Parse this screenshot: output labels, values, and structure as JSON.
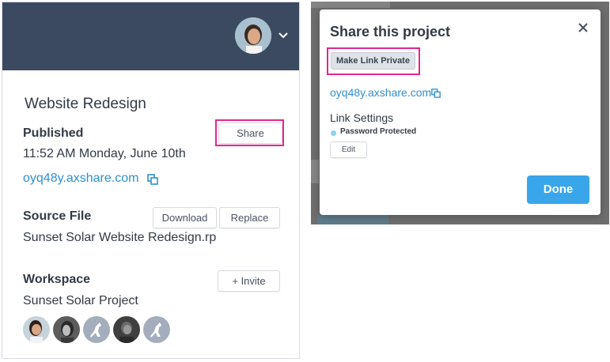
{
  "project_panel": {
    "title": "Website Redesign",
    "published": {
      "label": "Published",
      "timestamp": "11:52 AM Monday, June 10th",
      "link": "oyq48y.axshare.com",
      "share_label": "Share"
    },
    "source_file": {
      "label": "Source File",
      "filename": "Sunset Solar Website Redesign.rp",
      "download_label": "Download",
      "replace_label": "Replace"
    },
    "workspace": {
      "label": "Workspace",
      "name": "Sunset Solar Project",
      "invite_label": "+ Invite"
    }
  },
  "share_modal": {
    "title": "Share this project",
    "make_private_label": "Make Link Private",
    "link": "oyq48y.axshare.com",
    "link_settings_label": "Link Settings",
    "protection_status": "Password Protected",
    "edit_label": "Edit",
    "done_label": "Done"
  },
  "icons": {
    "copy": "copy-icon",
    "close": "close-icon",
    "chevron": "chevron-down-icon",
    "kangaroo": "kangaroo-icon"
  },
  "colors": {
    "header": "#3c4a61",
    "link": "#2f8fd1",
    "accent": "#3aa6ea",
    "highlight": "#e2278e",
    "status_dot": "#8fd3f0"
  }
}
